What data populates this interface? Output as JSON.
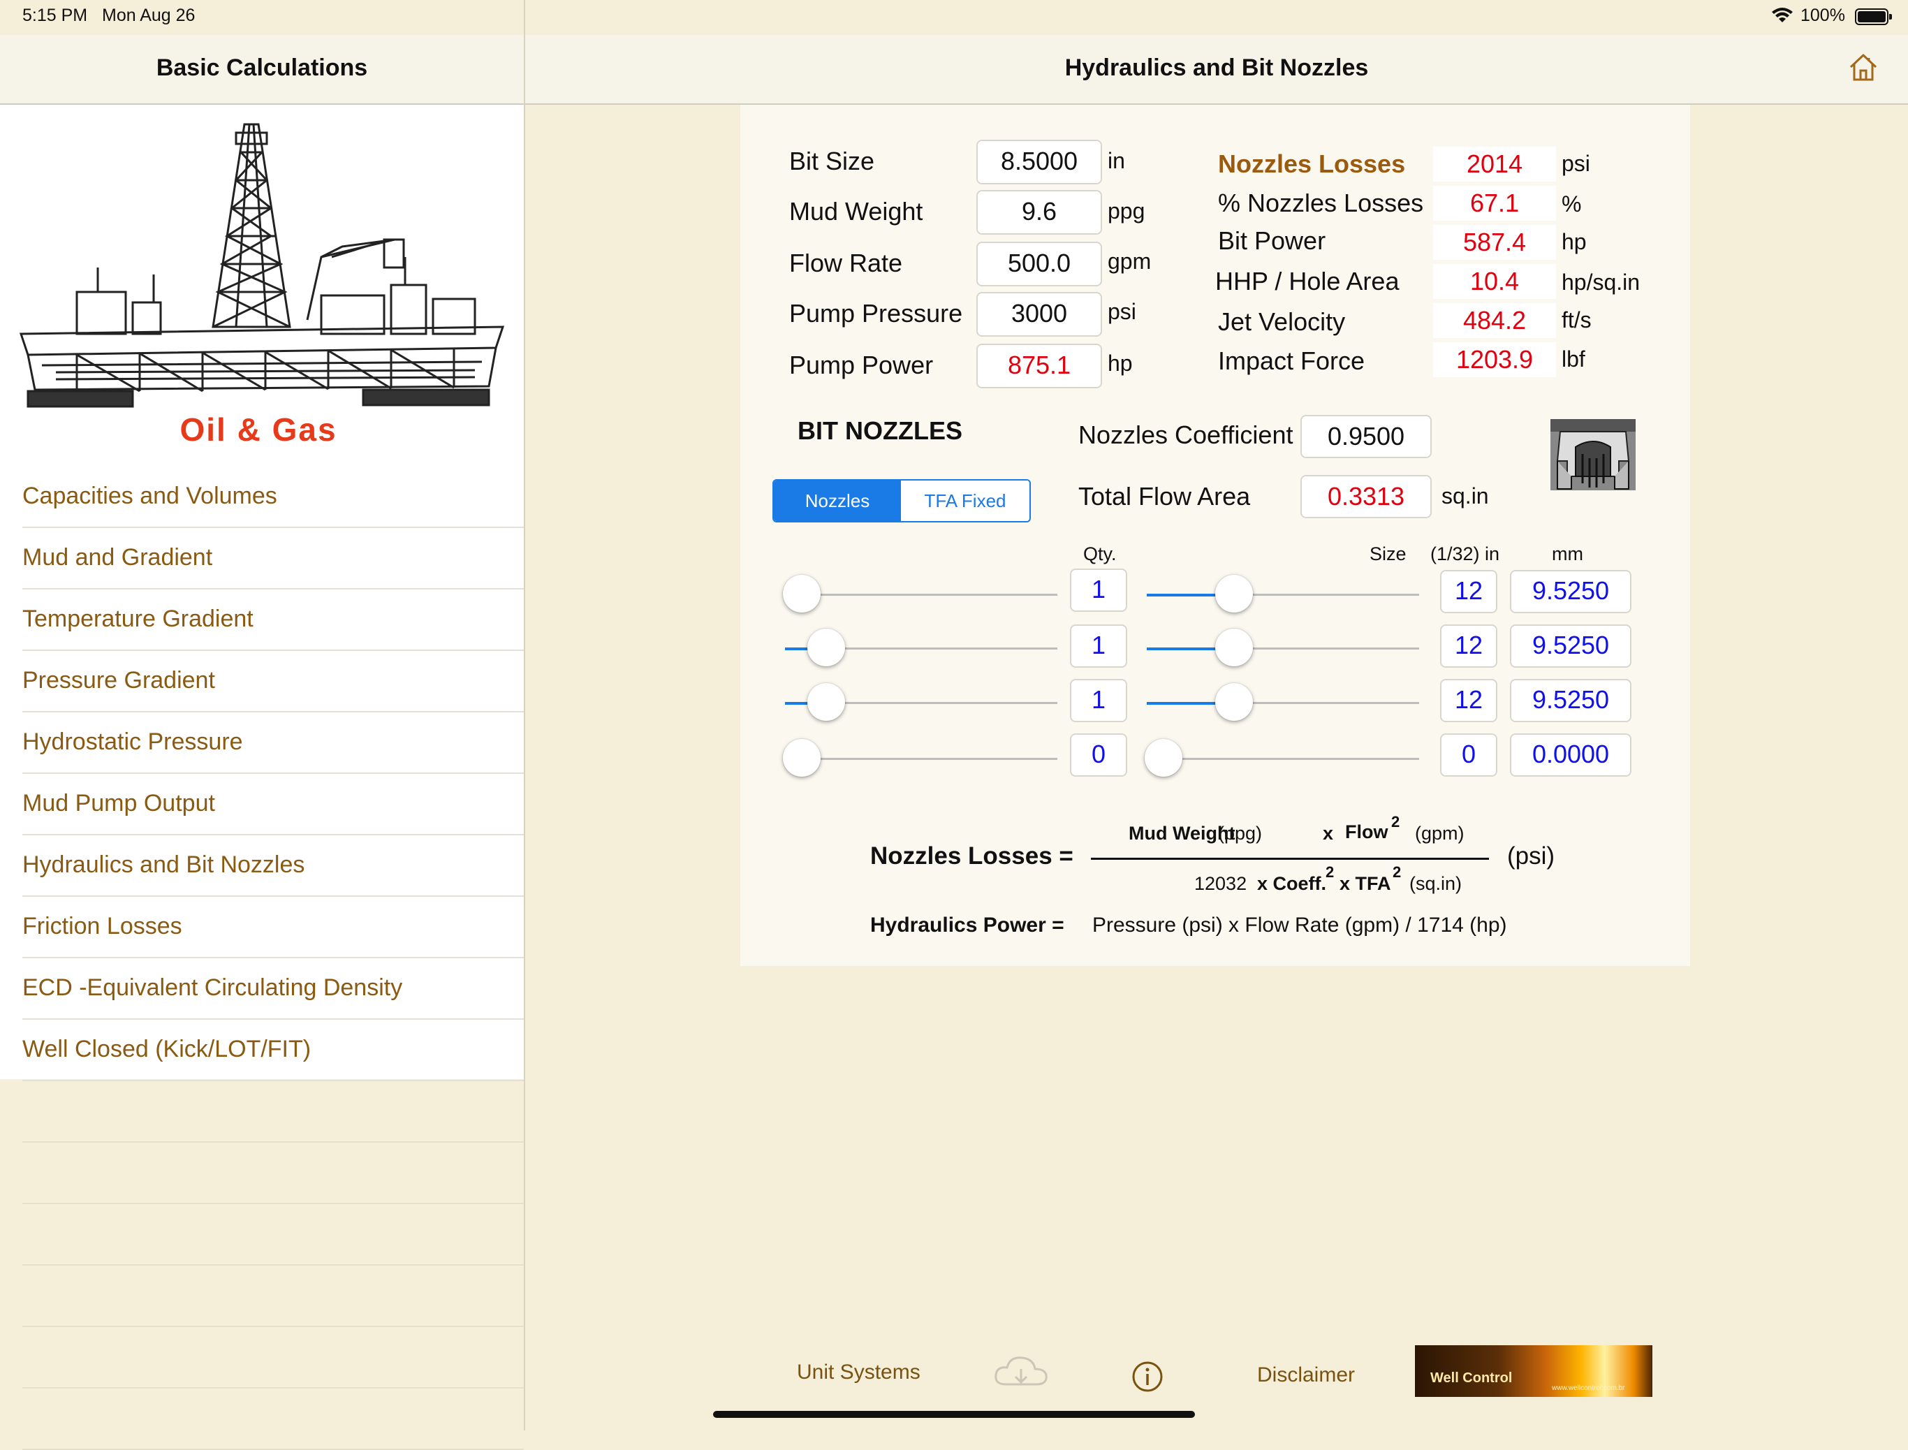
{
  "status_bar": {
    "time": "5:15 PM",
    "date": "Mon Aug 26",
    "battery": "100%"
  },
  "sidebar": {
    "title": "Basic Calculations",
    "logo_text": "Oil & Gas",
    "items": [
      {
        "label": "Capacities and Volumes"
      },
      {
        "label": "Mud and Gradient"
      },
      {
        "label": "Temperature Gradient"
      },
      {
        "label": "Pressure Gradient"
      },
      {
        "label": "Hydrostatic Pressure"
      },
      {
        "label": "Mud Pump Output"
      },
      {
        "label": "Hydraulics and Bit Nozzles"
      },
      {
        "label": "Friction Losses"
      },
      {
        "label": "ECD -Equivalent Circulating Density"
      },
      {
        "label": "Well Closed (Kick/LOT/FIT)"
      }
    ]
  },
  "header": {
    "title": "Hydraulics and Bit Nozzles",
    "home_icon": "home-icon"
  },
  "inputs": [
    {
      "label": "Bit Size",
      "value": "8.5000",
      "unit": "in"
    },
    {
      "label": "Mud Weight",
      "value": "9.6",
      "unit": "ppg"
    },
    {
      "label": "Flow Rate",
      "value": "500.0",
      "unit": "gpm"
    },
    {
      "label": "Pump Pressure",
      "value": "3000",
      "unit": "psi"
    },
    {
      "label": "Pump Power",
      "value": "875.1",
      "unit": "hp"
    }
  ],
  "results": [
    {
      "label": "Nozzles Losses",
      "value": "2014",
      "unit": "psi"
    },
    {
      "label": "% Nozzles Losses",
      "value": "67.1",
      "unit": "%"
    },
    {
      "label": "Bit Power",
      "value": "587.4",
      "unit": "hp"
    },
    {
      "label": "HHP / Hole Area",
      "value": "10.4",
      "unit": "hp/sq.in"
    },
    {
      "label": "Jet Velocity",
      "value": "484.2",
      "unit": "ft/s"
    },
    {
      "label": "Impact Force",
      "value": "1203.9",
      "unit": "lbf"
    }
  ],
  "bit_nozzles": {
    "title": "BIT NOZZLES",
    "segments": [
      "Nozzles",
      "TFA Fixed"
    ],
    "selected_segment": "Nozzles",
    "coefficient_label": "Nozzles Coefficient",
    "coefficient_value": "0.9500",
    "tfa_label": "Total Flow Area",
    "tfa_value": "0.3313",
    "tfa_unit": "sq.in",
    "nozzle_icon": "bit-nozzle-diagram-icon",
    "col_qty": "Qty.",
    "col_size": "Size",
    "col_in": "(1/32) in",
    "col_mm": "mm",
    "rows": [
      {
        "qty": "1",
        "size": "12",
        "mm": "9.5250",
        "qty_level": 0.0,
        "size_level": 0.26
      },
      {
        "qty": "1",
        "size": "12",
        "mm": "9.5250",
        "qty_level": 0.09,
        "size_level": 0.26
      },
      {
        "qty": "1",
        "size": "12",
        "mm": "9.5250",
        "qty_level": 0.09,
        "size_level": 0.26
      },
      {
        "qty": "0",
        "size": "0",
        "mm": "0.0000",
        "qty_level": 0.0,
        "size_level": 0.0
      }
    ]
  },
  "formula": {
    "nozzle_lhs": "Nozzles Losses =",
    "num_mw": "Mud Weight",
    "num_ppg": "(ppg)",
    "num_x": "x",
    "num_flow": "Flow",
    "num_exp": "2",
    "num_gpm": "(gpm)",
    "den_const": "12032",
    "den_coeff": "x Coeff.",
    "den_exp1": "2",
    "den_tfa": "x TFA",
    "den_exp2": "2",
    "den_unit": "(sq.in)",
    "rhs_unit": "(psi)",
    "hp_lhs": "Hydraulics Power =",
    "hp_rhs": "Pressure (psi) x Flow Rate (gpm) / 1714 (hp)"
  },
  "bottom_bar": {
    "unit_systems": "Unit Systems",
    "disclaimer": "Disclaimer",
    "cloud_icon": "cloud-download-icon",
    "info_icon": "info-icon",
    "logo_text": "Well Control",
    "logo_sub": "www.wellcontrol.com.br"
  },
  "colors": {
    "accent": "#1a7ae6",
    "result_red": "#e0000e",
    "nozzle_blue": "#1010ee",
    "menu_brown": "#8a5a12",
    "background": "#f5efd9"
  }
}
